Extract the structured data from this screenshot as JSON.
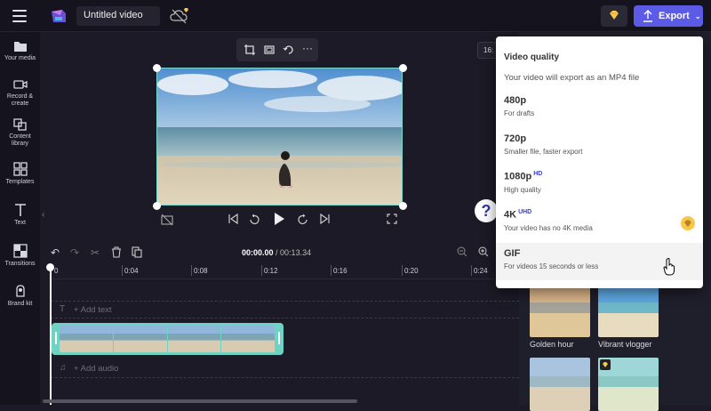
{
  "header": {
    "title": "Untitled video",
    "export_label": "Export"
  },
  "sidebar": {
    "items": [
      {
        "label": "Your media",
        "icon": "folder-icon"
      },
      {
        "label": "Record & create",
        "icon": "camera-icon"
      },
      {
        "label": "Content library",
        "icon": "library-icon"
      },
      {
        "label": "Templates",
        "icon": "templates-icon"
      },
      {
        "label": "Text",
        "icon": "text-icon"
      },
      {
        "label": "Transitions",
        "icon": "transitions-icon"
      },
      {
        "label": "Brand kit",
        "icon": "brand-kit-icon"
      }
    ]
  },
  "stage": {
    "ratio": "16:"
  },
  "timeline": {
    "current_time": "00:00.00",
    "duration": "/ 00:13.34",
    "ticks": [
      "0",
      "0:04",
      "0:08",
      "0:12",
      "0:16",
      "0:20",
      "0:24"
    ],
    "add_text": "+ Add text",
    "add_audio": "+ Add audio"
  },
  "right_panel": {
    "thumbs": [
      {
        "label": "Golden hour"
      },
      {
        "label": "Vibrant vlogger"
      }
    ]
  },
  "export_menu": {
    "heading": "Video quality",
    "subheading": "Your video will export as an MP4 file",
    "options": [
      {
        "title": "480p",
        "badge": "",
        "sub": "For drafts",
        "premium": false
      },
      {
        "title": "720p",
        "badge": "",
        "sub": "Smaller file, faster export",
        "premium": false
      },
      {
        "title": "1080p",
        "badge": "HD",
        "sub": "High quality",
        "premium": false
      },
      {
        "title": "4K",
        "badge": "UHD",
        "sub": "Your video has no 4K media",
        "premium": true
      },
      {
        "title": "GIF",
        "badge": "",
        "sub": "For videos 15 seconds or less",
        "premium": false
      }
    ]
  },
  "colors": {
    "accent": "#5b5be6",
    "clip": "#6fd3c4",
    "premium": "#f7c64b"
  }
}
